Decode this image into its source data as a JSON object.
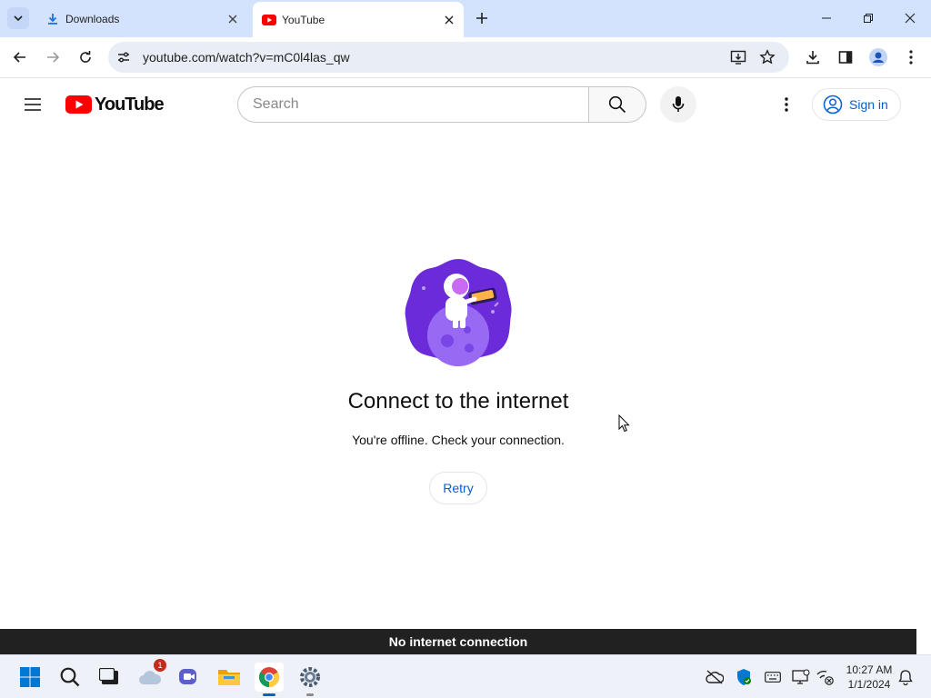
{
  "browser": {
    "tabs": [
      {
        "title": "Downloads",
        "icon": "download-icon",
        "active": false
      },
      {
        "title": "YouTube",
        "icon": "youtube-favicon",
        "active": true
      }
    ],
    "url": "youtube.com/watch?v=mC0l4las_qw"
  },
  "youtube": {
    "logo_text": "YouTube",
    "search_placeholder": "Search",
    "sign_in_label": "Sign in"
  },
  "offline": {
    "title": "Connect to the internet",
    "message": "You're offline. Check your connection.",
    "retry_label": "Retry",
    "banner": "No internet connection"
  },
  "taskbar": {
    "apps": [
      "start-icon",
      "search-icon",
      "task-view-icon",
      "onedrive-icon",
      "teams-icon",
      "file-explorer-icon",
      "chrome-icon",
      "settings-icon"
    ],
    "onedrive_badge": "1",
    "time": "10:27 AM",
    "date": "1/1/2024"
  },
  "colors": {
    "tabstrip_bg": "#d3e3fd",
    "youtube_red": "#ff0000",
    "link_blue": "#065fd4",
    "banner_bg": "#212121",
    "illustration_purple": "#6b2bd9"
  }
}
